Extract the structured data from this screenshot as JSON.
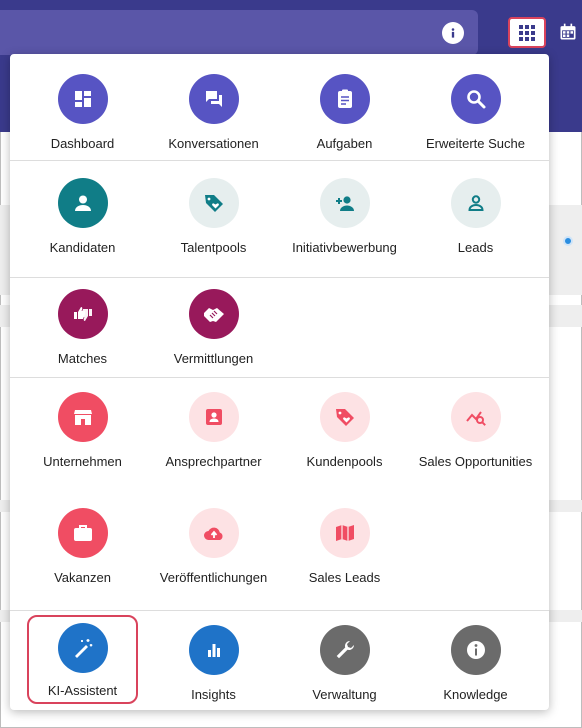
{
  "colors": {
    "topbar": "#3a3a8c",
    "accent_red": "#d9435c",
    "indigo": "#5754c3",
    "teal": "#107d87",
    "teal_light": "#e6eeee",
    "plum": "#98195b",
    "rose": "#f04d63",
    "rose_light": "#fde2e4",
    "blue": "#1f73c8",
    "gray": "#6b6b6b"
  },
  "header": {
    "info_icon": "info-icon",
    "apps_icon": "apps-grid-icon",
    "calendar_icon": "calendar-icon"
  },
  "menu": {
    "groups": [
      {
        "items": [
          {
            "label": "Dashboard",
            "icon": "dashboard-icon",
            "style": "indigo"
          },
          {
            "label": "Konversationen",
            "icon": "chat-icon",
            "style": "indigo"
          },
          {
            "label": "Aufgaben",
            "icon": "clipboard-icon",
            "style": "indigo"
          },
          {
            "label": "Erweiterte Suche",
            "icon": "search-icon",
            "style": "indigo"
          }
        ]
      },
      {
        "items": [
          {
            "label": "Kandidaten",
            "icon": "person-icon",
            "style": "teal"
          },
          {
            "label": "Talentpools",
            "icon": "tag-heart-icon",
            "style": "teal_light"
          },
          {
            "label": "Initiativbewerbung",
            "icon": "person-add-icon",
            "style": "teal_light"
          },
          {
            "label": "Leads",
            "icon": "person-outline-icon",
            "style": "teal_light"
          }
        ]
      },
      {
        "items": [
          {
            "label": "Matches",
            "icon": "thumbs-icon",
            "style": "plum"
          },
          {
            "label": "Vermittlungen",
            "icon": "handshake-icon",
            "style": "plum"
          }
        ]
      },
      {
        "items": [
          {
            "label": "Unternehmen",
            "icon": "store-icon",
            "style": "rose"
          },
          {
            "label": "Ansprechpartner",
            "icon": "contact-card-icon",
            "style": "rose_light"
          },
          {
            "label": "Kundenpools",
            "icon": "tag-heart-icon",
            "style": "rose_light"
          },
          {
            "label": "Sales Opportunities",
            "icon": "trend-search-icon",
            "style": "rose_light"
          },
          {
            "label": "Vakanzen",
            "icon": "briefcase-icon",
            "style": "rose"
          },
          {
            "label": "Veröffentlichungen",
            "icon": "cloud-upload-icon",
            "style": "rose_light"
          },
          {
            "label": "Sales Leads",
            "icon": "map-icon",
            "style": "rose_light"
          }
        ]
      },
      {
        "items": [
          {
            "label": "KI-Assistent",
            "icon": "magic-wand-icon",
            "style": "blue"
          },
          {
            "label": "Insights",
            "icon": "bar-chart-icon",
            "style": "blue"
          },
          {
            "label": "Verwaltung",
            "icon": "wrench-icon",
            "style": "gray"
          },
          {
            "label": "Knowledge",
            "icon": "info-icon",
            "style": "gray"
          }
        ]
      }
    ]
  }
}
